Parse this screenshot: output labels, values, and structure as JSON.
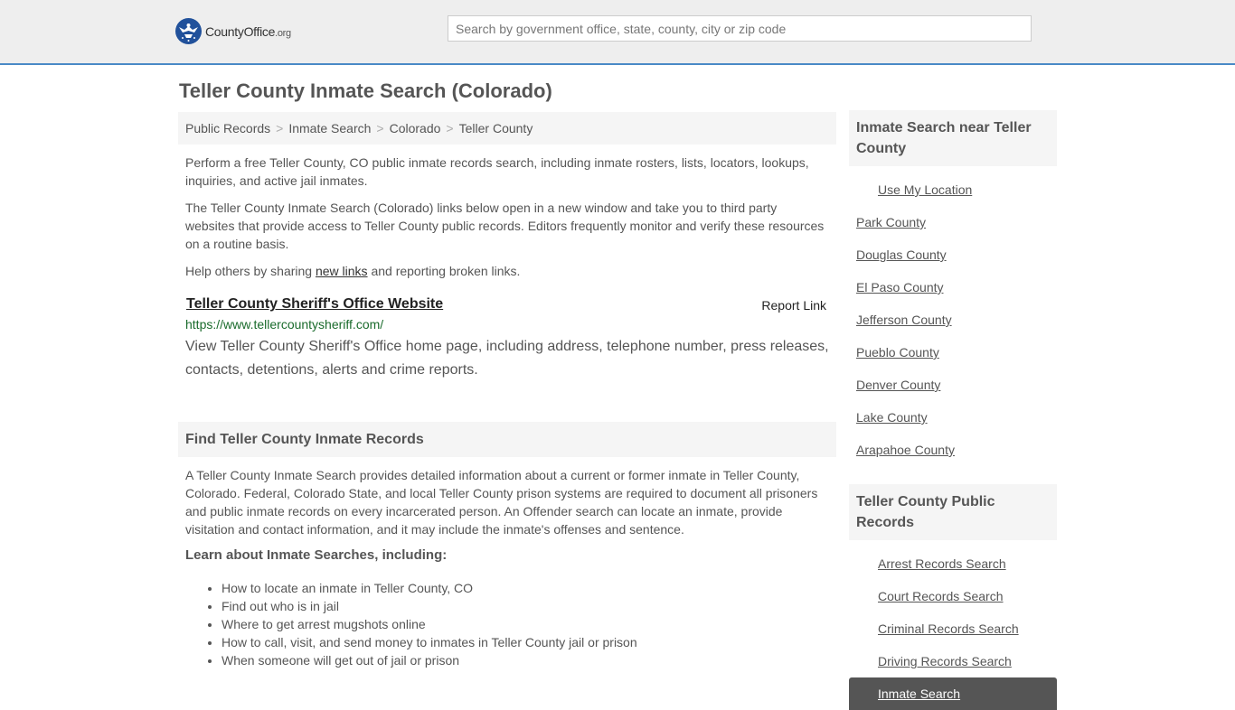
{
  "header": {
    "logo_county": "County",
    "logo_office": "Office",
    "logo_org": ".org",
    "search_placeholder": "Search by government office, state, county, city or zip code"
  },
  "page_title": "Teller County Inmate Search (Colorado)",
  "breadcrumb": [
    "Public Records",
    "Inmate Search",
    "Colorado",
    "Teller County"
  ],
  "intro": {
    "p1": "Perform a free Teller County, CO public inmate records search, including inmate rosters, lists, locators, lookups, inquiries, and active jail inmates.",
    "p2": "The Teller County Inmate Search (Colorado) links below open in a new window and take you to third party websites that provide access to Teller County public records. Editors frequently monitor and verify these resources on a routine basis.",
    "p3_before": "Help others by sharing ",
    "p3_link": "new links",
    "p3_after": " and reporting broken links."
  },
  "result": {
    "title": "Teller County Sheriff's Office Website",
    "report": "Report Link",
    "url": "https://www.tellercountysheriff.com/",
    "description": "View Teller County Sheriff's Office home page, including address, telephone number, press releases, contacts, detentions, alerts and crime reports."
  },
  "find_section": {
    "heading": "Find Teller County Inmate Records",
    "body": "A Teller County Inmate Search provides detailed information about a current or former inmate in Teller County, Colorado. Federal, Colorado State, and local Teller County prison systems are required to document all prisoners and public inmate records on every incarcerated person. An Offender search can locate an inmate, provide visitation and contact information, and it may include the inmate's offenses and sentence.",
    "learn_heading": "Learn about Inmate Searches, including:",
    "items": [
      "How to locate an inmate in Teller County, CO",
      "Find out who is in jail",
      "Where to get arrest mugshots online",
      "How to call, visit, and send money to inmates in Teller County jail or prison",
      "When someone will get out of jail or prison"
    ]
  },
  "sidebar_near": {
    "heading": "Inmate Search near Teller County",
    "use_location": "Use My Location",
    "counties": [
      "Park County",
      "Douglas County",
      "El Paso County",
      "Jefferson County",
      "Pueblo County",
      "Denver County",
      "Lake County",
      "Arapahoe County"
    ]
  },
  "sidebar_records": {
    "heading": "Teller County Public Records",
    "items": [
      "Arrest Records Search",
      "Court Records Search",
      "Criminal Records Search",
      "Driving Records Search",
      "Inmate Search"
    ],
    "active_index": 4
  },
  "colors": {
    "accent_border": "#4a8ac6",
    "logo_blue": "#21519b",
    "url_green": "#1a6b2c",
    "active_bg": "#555555"
  }
}
